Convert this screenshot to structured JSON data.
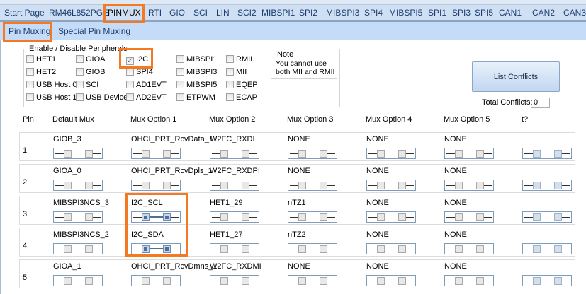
{
  "tabs": [
    "Start Page",
    "RM46L852PGE",
    "PINMUX",
    "RTI",
    "GIO",
    "SCI",
    "LIN",
    "SCI2",
    "MIBSPI1",
    "SPI2",
    "MIBSPI3",
    "SPI4",
    "MIBSPI5",
    "SPI1",
    "SPI3",
    "SPI5",
    "CAN1",
    "CAN2",
    "CAN3"
  ],
  "active_tab": "PINMUX",
  "subtabs": [
    "Pin Muxing",
    "Special Pin Muxing"
  ],
  "peripherals": {
    "title": "Enable / Disable Peripherals",
    "items": [
      {
        "label": "HET1",
        "checked": false
      },
      {
        "label": "HET2",
        "checked": false
      },
      {
        "label": "USB Host 0",
        "checked": false
      },
      {
        "label": "USB Host 1",
        "checked": false
      },
      {
        "label": "GIOA",
        "checked": false
      },
      {
        "label": "GIOB",
        "checked": false
      },
      {
        "label": "SCI",
        "checked": false
      },
      {
        "label": "USB Device",
        "checked": false
      },
      {
        "label": "I2C",
        "checked": true
      },
      {
        "label": "SPI4",
        "checked": false
      },
      {
        "label": "AD1EVT",
        "checked": false
      },
      {
        "label": "AD2EVT",
        "checked": false
      },
      {
        "label": "MIBSPI1",
        "checked": false
      },
      {
        "label": "MIBSPI3",
        "checked": false
      },
      {
        "label": "MIBSPI5",
        "checked": false
      },
      {
        "label": "ETPWM",
        "checked": false
      },
      {
        "label": "RMII",
        "checked": false
      },
      {
        "label": "MII",
        "checked": false
      },
      {
        "label": "EQEP",
        "checked": false
      },
      {
        "label": "ECAP",
        "checked": false
      }
    ]
  },
  "note": {
    "title": "Note",
    "text1": "You cannot use",
    "text2": "both MII and RMII"
  },
  "list_conflicts": "List Conflicts",
  "total_conflicts_label": "Total Conflicts:",
  "total_conflicts_value": "0",
  "columns": [
    "Pin",
    "Default Mux",
    "Mux Option 1",
    "Mux Option 2",
    "Mux Option 3",
    "Mux Option 4",
    "Mux Option 5",
    "t?"
  ],
  "rows": [
    {
      "pin": "1",
      "mux": [
        "GIOB_3",
        "OHCI_PRT_RcvData_1",
        "W2FC_RXDI",
        "NONE",
        "NONE",
        "NONE",
        ""
      ],
      "selected": -1
    },
    {
      "pin": "2",
      "mux": [
        "GIOA_0",
        "OHCI_PRT_RcvDpls_1",
        "W2FC_RXDPI",
        "NONE",
        "NONE",
        "NONE",
        ""
      ],
      "selected": -1
    },
    {
      "pin": "3",
      "mux": [
        "MIBSPI3NCS_3",
        "I2C_SCL",
        "HET1_29",
        "nTZ1",
        "NONE",
        "NONE",
        ""
      ],
      "selected": 1
    },
    {
      "pin": "4",
      "mux": [
        "MIBSPI3NCS_2",
        "I2C_SDA",
        "HET1_27",
        "nTZ2",
        "NONE",
        "NONE",
        ""
      ],
      "selected": 1
    },
    {
      "pin": "5",
      "mux": [
        "GIOA_1",
        "OHCI_PRT_RcvDmns_1",
        "W2FC_RXDMI",
        "NONE",
        "NONE",
        "NONE",
        ""
      ],
      "selected": -1
    }
  ],
  "highlight_color": "#f47920"
}
